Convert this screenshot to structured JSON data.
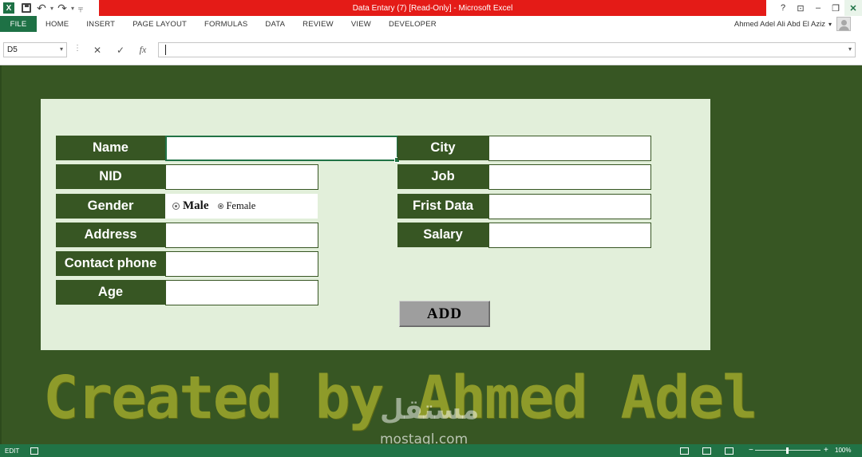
{
  "window": {
    "title": "Data Entary (7)  [Read-Only] -  Microsoft Excel",
    "help": "?",
    "restore_ribbon": "⊡",
    "minimize": "–",
    "maximize": "❐",
    "close": "✕"
  },
  "qat": {
    "logo_letter": "X",
    "undo": "↶",
    "redo": "↷",
    "dropdown": "▾",
    "customize": "╤"
  },
  "ribbon": {
    "tabs": [
      "FILE",
      "HOME",
      "INSERT",
      "PAGE LAYOUT",
      "FORMULAS",
      "DATA",
      "REVIEW",
      "VIEW",
      "DEVELOPER"
    ],
    "user_name": "Ahmed Adel Ali Abd El Aziz",
    "user_dropdown": "▾"
  },
  "formula_bar": {
    "name_box": "D5",
    "name_dropdown": "▾",
    "dots": "⋮",
    "cancel": "✕",
    "enter": "✓",
    "fx": "fx",
    "value": "",
    "expand": "▾"
  },
  "form": {
    "left_labels": [
      "Name",
      "NID",
      "Gender",
      "Address",
      "Contact phone",
      "Age"
    ],
    "right_labels": [
      "City",
      "Job",
      "Frist Data",
      "Salary"
    ],
    "gender_options": [
      "Male",
      "Female"
    ],
    "add_button": "ADD"
  },
  "banner": {
    "text": "Created by Ahmed Adel",
    "watermark_ar": "مستقل",
    "watermark_en": "mostaql.com"
  },
  "status": {
    "mode": "EDIT",
    "zoom_minus": "−",
    "zoom_plus": "+",
    "zoom": "100%"
  },
  "colors": {
    "excel_green": "#217346",
    "sheet_green": "#375623",
    "panel_bg": "#e2efda",
    "title_red": "#e41b17",
    "banner_text": "#8e9b2a"
  }
}
